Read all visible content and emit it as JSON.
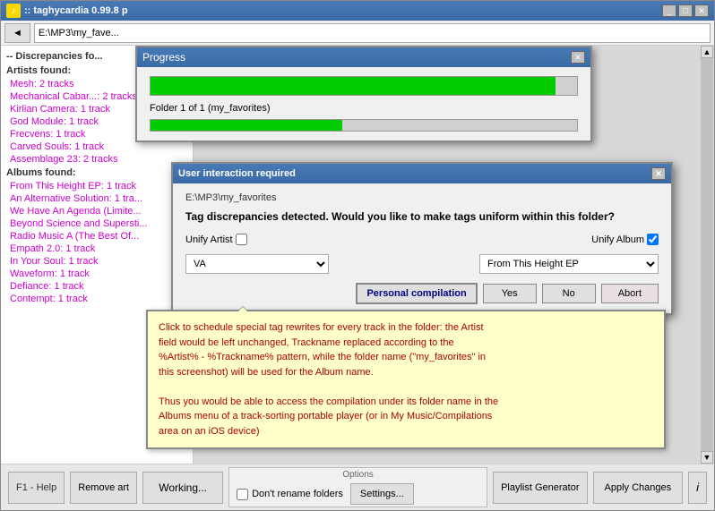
{
  "titleBar": {
    "icon": "♪",
    "title": ":: taghycardia 0.99.8 p",
    "minimizeLabel": "_",
    "maximizeLabel": "□",
    "closeLabel": "✕"
  },
  "progressDialog": {
    "title": "Progress",
    "closeLabel": "✕",
    "folderLabel": "Folder 1 of 1 (my_favorites)",
    "mainBarPercent": 95,
    "subBarPercent": 45
  },
  "toolbar": {
    "backLabel": "◄",
    "path": "E:\\MP3\\my_fave..."
  },
  "leftPanel": {
    "sectionDiscrepancies": "-- Discrepancies fo...",
    "artistsFound": "Artists found:",
    "artists": [
      "Mesh: 2 tracks",
      "Mechanical Cabar...: 2 tracks",
      "Kirlian Camera: 1 track",
      "God Module: 1 track",
      "Frecvens: 1 track",
      "Carved Souls: 1 track",
      "Assemblage 23: 2 tracks"
    ],
    "albumsFound": "Albums found:",
    "albums": [
      "From This Height EP: 1 track",
      "An Alternative Solution: 1 tra...",
      "We Have An Agenda (Limite...",
      "Beyond Science and Supersiti...",
      "Radio Music A (The Best Of...",
      "Empath 2.0: 1 track",
      "In Your Soul: 1 track",
      "Waveform: 1 track",
      "Defiance: 1 track",
      "Contempt: 1 track"
    ]
  },
  "userDialog": {
    "title": "User interaction required",
    "closeLabel": "✕",
    "path": "E:\\MP3\\my_favorites",
    "question": "Tag discrepancies detected. Would you like to make tags uniform within this folder?",
    "unifyArtistLabel": "Unify Artist",
    "unifyAlbumLabel": "Unify Album",
    "unifyArtistChecked": false,
    "unifyAlbumChecked": true,
    "artistValue": "VA",
    "albumValue": "From This Height EP",
    "personalCompilationLabel": "Personal compilation",
    "yesLabel": "Yes",
    "noLabel": "No",
    "abortLabel": "Abort"
  },
  "helpBalloon": {
    "line1": "Click to schedule special tag rewrites for every track in the folder: the Artist",
    "line2": "field would be left unchanged, Trackname replaced according to the",
    "line3": "%Artist% - %Trackname% pattern, while the folder name (\"my_favorites\" in",
    "line4": "this screenshot) will be used for the Album name.",
    "line5": "",
    "line6": "Thus you would be able to access the compilation under its folder name in the",
    "line7": "Albums menu of a track-sorting portable player (or in My Music/Compilations",
    "line8": "area on an iOS device)"
  },
  "bottomBar": {
    "f1HelpLabel": "F1 - Help",
    "removeArtLabel": "Remove art",
    "workingLabel": "Working...",
    "optionsLabel": "Options",
    "dontRenameFoldersLabel": "Don't rename folders",
    "settingsLabel": "Settings...",
    "playlistGeneratorLabel": "Playlist Generator",
    "applyChangesLabel": "Apply Changes",
    "infoLabel": "i"
  }
}
